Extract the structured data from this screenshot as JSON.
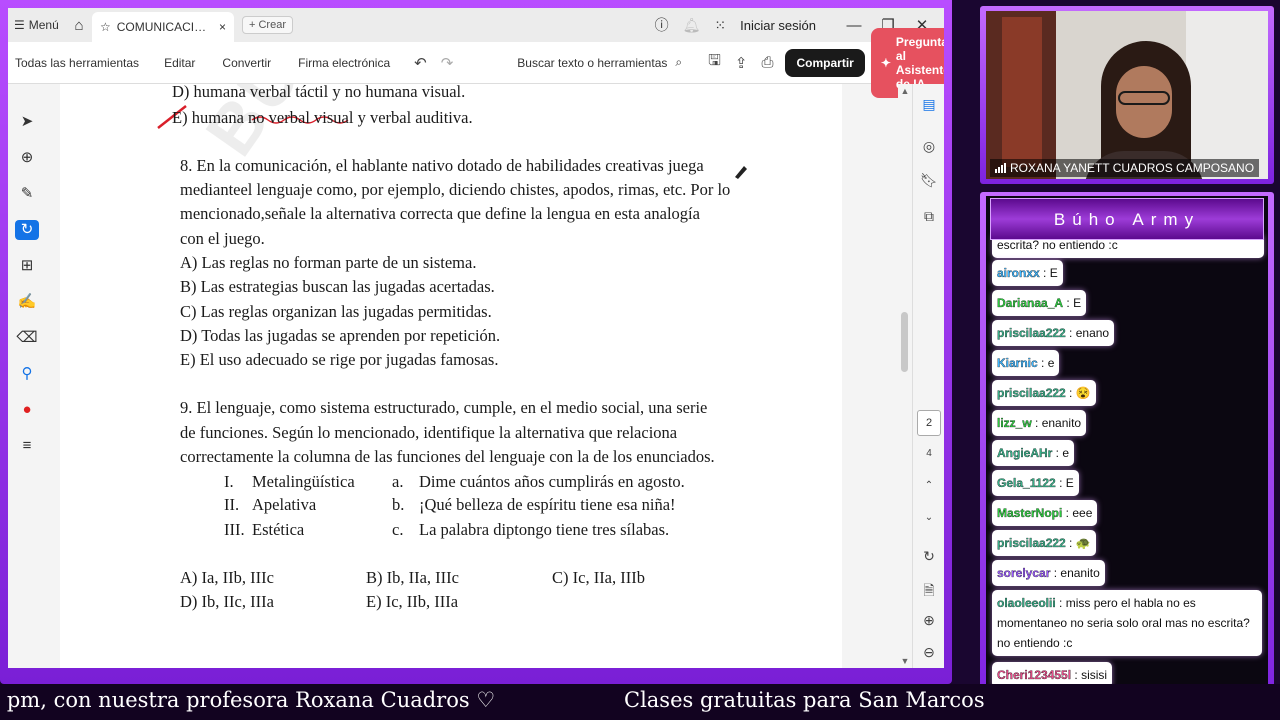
{
  "window": {
    "menu_label": "Menú",
    "tab_title": "COMUNICACIÓN – ...",
    "new_tab": "Crear",
    "sign_in": "Iniciar sesión"
  },
  "toolbar": {
    "all_tools": "Todas las herramientas",
    "edit": "Editar",
    "convert": "Convertir",
    "sign": "Firma electrónica",
    "search": "Buscar texto o herramientas",
    "share": "Compartir",
    "ai": "Pregunta al Asistente de IA"
  },
  "document": {
    "prev_d": "D) humana verbal táctil y no humana visual.",
    "prev_e": "E) humana no verbal visual y verbal auditiva.",
    "q8_lines": [
      "8. En la comunicación, el hablante nativo dotado de habilidades creativas juega",
      "medianteel lenguaje como, por ejemplo, diciendo chistes, apodos, rimas, etc. Por lo",
      "mencionado,señale la alternativa correcta que define la lengua en esta analogía",
      "con el juego."
    ],
    "q8_options": [
      "A) Las reglas no forman parte de un sistema.",
      "B) Las estrategias buscan las jugadas acertadas.",
      "C) Las reglas organizan las jugadas permitidas.",
      "D) Todas las jugadas se aprenden por repetición.",
      "E) El uso adecuado se rige por jugadas famosas."
    ],
    "q9_lines": [
      "9. El lenguaje, como sistema estructurado, cumple, en el medio social, una serie",
      "de funciones. Según lo mencionado, identifique la alternativa que relaciona",
      "correctamente la columna de las funciones del lenguaje con la de los enunciados."
    ],
    "q9_table": [
      {
        "num": "I.",
        "func": "Metalingüística",
        "let": "a.",
        "text": "Dime cuántos años cumplirás en agosto."
      },
      {
        "num": "II.",
        "func": "Apelativa",
        "let": "b.",
        "text": "¡Qué belleza de espíritu tiene esa niña!"
      },
      {
        "num": "III.",
        "func": "Estética",
        "let": "c.",
        "text": "La palabra diptongo tiene tres sílabas."
      }
    ],
    "q9_answers": [
      "A) Ia, IIb, IIIc",
      "B) Ib, IIa, IIIc",
      "C) Ic, IIa, IIIb",
      "D) Ib, IIc, IIIa",
      "E) Ic, IIb, IIIa"
    ],
    "watermark": "BÚHO"
  },
  "page_nav": {
    "current": "2",
    "total": "4"
  },
  "camera": {
    "name": "ROXANA YANETT CUADROS CAMPOSANO"
  },
  "chat": {
    "title": "Búho Army",
    "top_cut": "escrita? no entiendo :c",
    "messages": [
      {
        "user": "aironxx",
        "text": "E",
        "color": "#3fb6ff"
      },
      {
        "user": "Darianaa_A",
        "text": "E",
        "color": "#2ecc40"
      },
      {
        "user": "priscilaa222",
        "text": "enano",
        "color": "#3ab08a"
      },
      {
        "user": "Kiarnic",
        "text": "e",
        "color": "#3fb6ff"
      },
      {
        "user": "priscilaa222",
        "text": "",
        "color": "#3ab08a"
      },
      {
        "user": "lizz_w",
        "text": "enanito",
        "color": "#2ecc40"
      },
      {
        "user": "AngieAHr",
        "text": "e",
        "color": "#3ab08a"
      },
      {
        "user": "Gela_1122",
        "text": "E",
        "color": "#3ab08a"
      },
      {
        "user": "MasterNopi",
        "text": "eee",
        "color": "#2ecc40"
      },
      {
        "user": "priscilaa222",
        "text": "",
        "color": "#3ab08a"
      },
      {
        "user": "sorelycar",
        "text": "enanito",
        "color": "#9b59ff"
      },
      {
        "user": "olaoleeolii",
        "text": "miss pero el habla no es momentaneo no seria solo oral mas no escrita? no entiendo :c",
        "color": "#3ab08a"
      },
      {
        "user": "Cheri123455l",
        "text": "sisisi",
        "color": "#e84c8a"
      }
    ]
  },
  "ticker": {
    "left": ") pm, con nuestra profesora Roxana Cuadros ♡",
    "right": "Clases gratuitas para San Marcos"
  }
}
